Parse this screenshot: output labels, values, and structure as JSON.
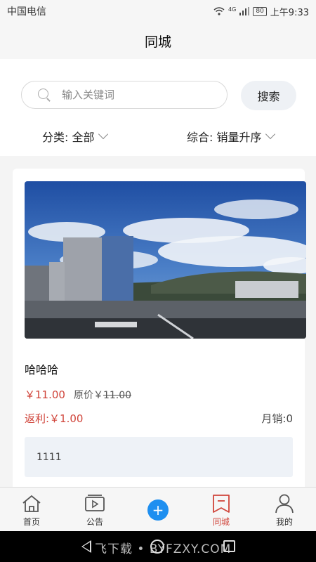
{
  "status_bar": {
    "carrier": "中国电信",
    "network": "4G",
    "battery": "80",
    "time": "上午9:33"
  },
  "header": {
    "title": "同城"
  },
  "search": {
    "placeholder": "输入关键词",
    "value": "",
    "button_label": "搜索"
  },
  "filters": {
    "category": "分类: 全部",
    "sort": "综合: 销量升序"
  },
  "product": {
    "name": "哈哈哈",
    "price": "￥11.00",
    "original_label": "原价￥",
    "original_price": "11.00",
    "rebate": "返利:￥1.00",
    "monthly_sales": "月销:0",
    "note": "1111"
  },
  "tabbar": {
    "items": [
      {
        "label": "首页",
        "icon": "home-icon"
      },
      {
        "label": "公告",
        "icon": "video-icon"
      },
      {
        "label": "",
        "icon": "add-icon"
      },
      {
        "label": "同城",
        "icon": "bookmark-icon",
        "active": true
      },
      {
        "label": "我的",
        "icon": "user-icon"
      }
    ]
  },
  "system_nav": {
    "watermark": "飞下载 • BYFZXY.COM"
  },
  "colors": {
    "accent_red": "#d0443a",
    "add_button_blue": "#1e8ff0"
  }
}
